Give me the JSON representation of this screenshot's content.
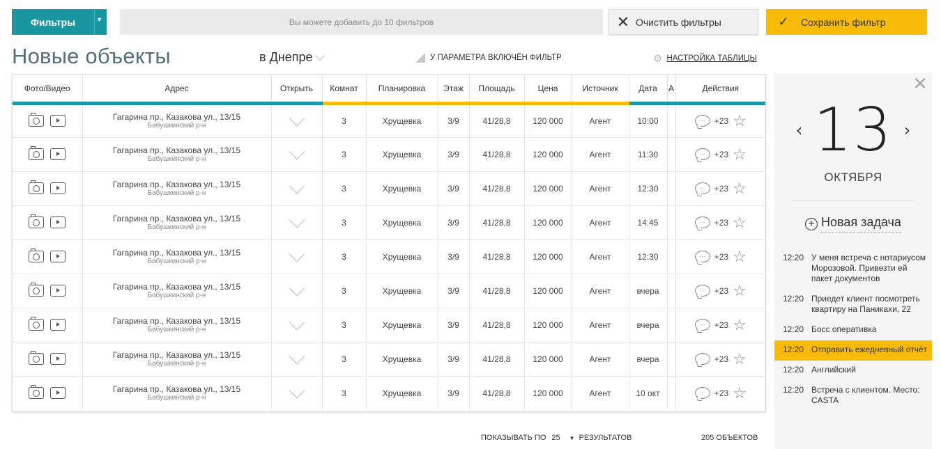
{
  "toolbar": {
    "filters_label": "Фильтры",
    "filter_hint": "Вы можете добавить до 10 фильтров",
    "clear_label": "Очистить фильтры",
    "save_label": "Сохранить фильтр"
  },
  "heading": {
    "title": "Новые объекты",
    "city": "в Днепре",
    "param_note": "У ПАРАМЕТРА ВКЛЮЧЁН ФИЛЬТР",
    "table_settings": "НАСТРОЙКА ТАБЛИЦЫ"
  },
  "table": {
    "columns": [
      "Фото/Видео",
      "Адрес",
      "Открыть",
      "Комнат",
      "Планировка",
      "Этаж",
      "Площадь",
      "Цена",
      "Источник",
      "Дата",
      "А",
      "Действия"
    ],
    "rows": [
      {
        "address": "Гагарина пр., Казакова ул., 13/15",
        "district": "Бабушкинский р-н",
        "rooms": "3",
        "layout": "Хрущевка",
        "floor": "3/9",
        "area": "41/28,8",
        "price": "120 000",
        "source": "Агент",
        "date": "10:00",
        "count": "+23"
      },
      {
        "address": "Гагарина пр., Казакова ул., 13/15",
        "district": "Бабушкинский р-н",
        "rooms": "3",
        "layout": "Хрущевка",
        "floor": "3/9",
        "area": "41/28,8",
        "price": "120 000",
        "source": "Агент",
        "date": "11:30",
        "count": "+23"
      },
      {
        "address": "Гагарина пр., Казакова ул., 13/15",
        "district": "Бабушкинский р-н",
        "rooms": "3",
        "layout": "Хрущевка",
        "floor": "3/9",
        "area": "41/28,8",
        "price": "120 000",
        "source": "Агент",
        "date": "12:30",
        "count": "+23"
      },
      {
        "address": "Гагарина пр., Казакова ул., 13/15",
        "district": "Бабушкинский р-н",
        "rooms": "3",
        "layout": "Хрущевка",
        "floor": "3/9",
        "area": "41/28,8",
        "price": "120 000",
        "source": "Агент",
        "date": "14:45",
        "count": "+23"
      },
      {
        "address": "Гагарина пр., Казакова ул., 13/15",
        "district": "Бабушкинский р-н",
        "rooms": "3",
        "layout": "Хрущевка",
        "floor": "3/9",
        "area": "41/28,8",
        "price": "120 000",
        "source": "Агент",
        "date": "12:30",
        "count": "+23"
      },
      {
        "address": "Гагарина пр., Казакова ул., 13/15",
        "district": "Бабушкинский р-н",
        "rooms": "3",
        "layout": "Хрущевка",
        "floor": "3/9",
        "area": "41/28,8",
        "price": "120 000",
        "source": "Агент",
        "date": "вчера",
        "count": "+23"
      },
      {
        "address": "Гагарина пр., Казакова ул., 13/15",
        "district": "Бабушкинский р-н",
        "rooms": "3",
        "layout": "Хрущевка",
        "floor": "3/9",
        "area": "41/28,8",
        "price": "120 000",
        "source": "Агент",
        "date": "вчера",
        "count": "+23"
      },
      {
        "address": "Гагарина пр., Казакова ул., 13/15",
        "district": "Бабушкинский р-н",
        "rooms": "3",
        "layout": "Хрущевка",
        "floor": "3/9",
        "area": "41/28,8",
        "price": "120 000",
        "source": "Агент",
        "date": "вчера",
        "count": "+23"
      },
      {
        "address": "Гагарина пр., Казакова ул., 13/15",
        "district": "Бабушкинский р-н",
        "rooms": "3",
        "layout": "Хрущевка",
        "floor": "3/9",
        "area": "41/28,8",
        "price": "120 000",
        "source": "Агент",
        "date": "10 окт",
        "count": "+23"
      }
    ]
  },
  "footer": {
    "show_label": "ПОКАЗЫВАТЬ ПО",
    "page_size": "25",
    "results_label": "РЕЗУЛЬТАТОВ",
    "total": "205 ОБЪЕКТОВ"
  },
  "panel": {
    "day": "13",
    "month": "ОКТЯБРЯ",
    "new_task": "Новая задача",
    "tasks": [
      {
        "time": "12:20",
        "text": "У меня встреча с нотариусом Морозовой. Привезти ей пакет документов",
        "active": false
      },
      {
        "time": "12:20",
        "text": "Приедет клиент посмотреть квартиру на Паникахи, 22",
        "active": false
      },
      {
        "time": "12:20",
        "text": "Босс оперативка",
        "active": false
      },
      {
        "time": "12:20",
        "text": "Отправить ежедневный отчёт",
        "active": true
      },
      {
        "time": "12:20",
        "text": "Английский",
        "active": false
      },
      {
        "time": "12:20",
        "text": "Встреча с клиентом. Место: CASTA",
        "active": false
      }
    ]
  },
  "icons": {
    "camera": "camera-icon",
    "video": "video-icon",
    "comment": "comment-icon",
    "star": "star-icon",
    "gear": "gear-icon",
    "close": "close-icon"
  },
  "colors": {
    "accent_teal": "#1a96a1",
    "accent_yellow": "#f9bb0a",
    "title": "#546e7a"
  }
}
